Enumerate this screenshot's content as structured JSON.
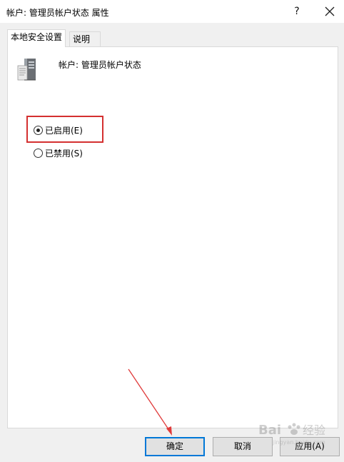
{
  "window": {
    "title": "帐户: 管理员帐户状态 属性",
    "help_label": "?",
    "close_label": "✕"
  },
  "tabs": [
    {
      "label": "本地安全设置",
      "active": true
    },
    {
      "label": "说明",
      "active": false
    }
  ],
  "policy": {
    "name": "帐户: 管理员帐户状态",
    "icon": "server-policy-icon"
  },
  "options": [
    {
      "label": "已启用(E)",
      "checked": true
    },
    {
      "label": "已禁用(S)",
      "checked": false
    }
  ],
  "buttons": {
    "ok": "确定",
    "cancel": "取消",
    "apply": "应用(A)"
  },
  "annotation": {
    "highlight_color": "#d43030",
    "arrow_color": "#e03a3a"
  },
  "watermark": {
    "text": "Bai 经验",
    "subtext": "jingyan.baidu.com"
  }
}
